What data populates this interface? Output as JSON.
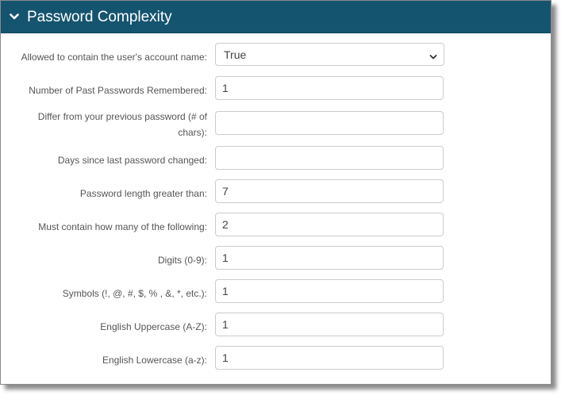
{
  "panel": {
    "title": "Password Complexity",
    "expanded": true,
    "header_color": "#15546f",
    "chevron_icon": "chevron-down-icon"
  },
  "fields": [
    {
      "label": "Allowed to contain the user's account name:",
      "type": "select",
      "value": "True"
    },
    {
      "label": "Number of Past Passwords Remembered:",
      "type": "text",
      "value": "1"
    },
    {
      "label": "Differ from your previous password (# of chars):",
      "type": "text",
      "value": ""
    },
    {
      "label": "Days since last password changed:",
      "type": "text",
      "value": ""
    },
    {
      "label": "Password length greater than:",
      "type": "text",
      "value": "7"
    },
    {
      "label": "Must contain how many of the following:",
      "type": "text",
      "value": "2"
    },
    {
      "label": "Digits (0-9):",
      "type": "text",
      "value": "1"
    },
    {
      "label": "Symbols (!, @, #, $, % , &, *, etc.):",
      "type": "text",
      "value": "1"
    },
    {
      "label": "English Uppercase (A-Z):",
      "type": "text",
      "value": "1"
    },
    {
      "label": "English Lowercase (a-z):",
      "type": "text",
      "value": "1"
    }
  ]
}
